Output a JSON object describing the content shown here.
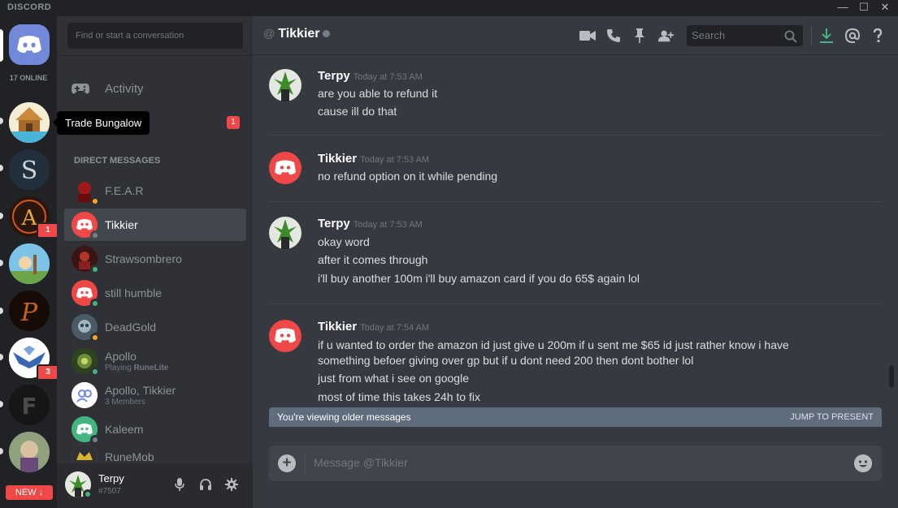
{
  "window": {
    "brand": "DISCORD",
    "min": "—",
    "max": "☐",
    "close": "✕"
  },
  "rail": {
    "online_count": "17 ONLINE",
    "new_button": "NEW ↓",
    "badges": [
      "1",
      "3"
    ],
    "tooltip": "Trade Bungalow"
  },
  "sidebar": {
    "search_placeholder": "Find or start a conversation",
    "activity_label": "Activity",
    "friends_badge": "1",
    "dm_header": "DIRECT MESSAGES",
    "dms": [
      {
        "name": "F.E.A.R",
        "status": "idle",
        "color": "#8b1414"
      },
      {
        "name": "Tikkier",
        "status": "offline",
        "color": "#f04747",
        "active": true
      },
      {
        "name": "Strawsombrero",
        "status": "online",
        "color": "#5a1f1f"
      },
      {
        "name": "still humble",
        "status": "online",
        "color": "#f04747"
      },
      {
        "name": "DeadGold",
        "status": "idle",
        "color": "#5b6f7a"
      },
      {
        "name": "Apollo",
        "status": "online",
        "color": "#3b5a2a",
        "sub_prefix": "Playing ",
        "sub_game": "RuneLite"
      },
      {
        "name": "Apollo, Tikkier",
        "status": "none",
        "color": "#ffffff",
        "sub": "3 Members"
      },
      {
        "name": "Kaleem",
        "status": "offline",
        "color": "#43b581"
      },
      {
        "name": "RuneMob",
        "status": "none",
        "color": "#c8a02a"
      }
    ]
  },
  "user": {
    "name": "Terpy",
    "tag": "#7507"
  },
  "header": {
    "at": "@",
    "name": "Tikkier",
    "search_placeholder": "Search"
  },
  "messages": [
    {
      "author": "Terpy",
      "time": "Today at 7:53 AM",
      "avatar": "terpy",
      "lines": [
        "are you able to refund it",
        "cause ill do that"
      ]
    },
    {
      "author": "Tikkier",
      "time": "Today at 7:53 AM",
      "avatar": "discord",
      "lines": [
        "no refund option on it while pending"
      ]
    },
    {
      "author": "Terpy",
      "time": "Today at 7:53 AM",
      "avatar": "terpy",
      "lines": [
        "okay word",
        "after it comes through",
        "i'll buy another 100m i'll buy amazon card if you do 65$ again lol"
      ]
    },
    {
      "author": "Tikkier",
      "time": "Today at 7:54 AM",
      "avatar": "discord",
      "lines": [
        "if u wanted to order the amazon id just give u 200m if u sent me $65 id just rather know i have",
        "something befoer giving over gp but if u dont need 200 then dont bother lol",
        "just from what i see on google",
        "most of time this takes 24h to fix"
      ]
    }
  ],
  "jump_bar": {
    "text": "You're viewing older messages",
    "action": "JUMP TO PRESENT"
  },
  "composer": {
    "placeholder": "Message @Tikkier"
  },
  "colors": {
    "blurple": "#7289da",
    "red": "#f04747",
    "online": "#43b581",
    "idle": "#faa61a",
    "offline": "#747f8d"
  }
}
